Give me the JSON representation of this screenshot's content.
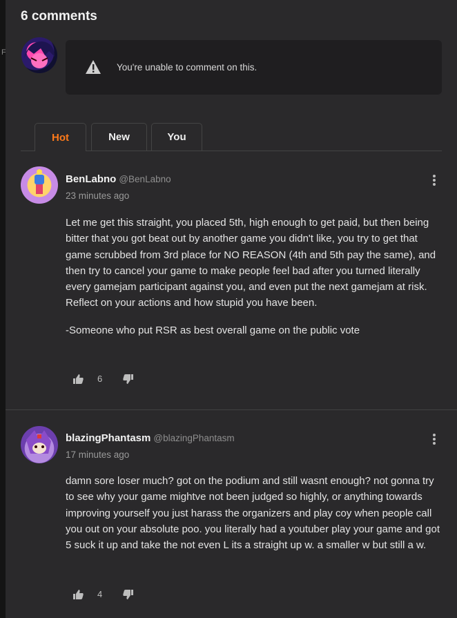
{
  "comments_header": {
    "title": "6 comments"
  },
  "notice": {
    "text": "You're unable to comment on this.",
    "icon": "warning-icon"
  },
  "tabs": [
    {
      "label": "Hot",
      "active": true
    },
    {
      "label": "New",
      "active": false
    },
    {
      "label": "You",
      "active": false
    }
  ],
  "sidebar": {
    "partial_letter": "F"
  },
  "colors": {
    "accent": "#ff7a1a",
    "background": "#2a292b",
    "notice_bg": "#1f1e20"
  },
  "comments": [
    {
      "name": "BenLabno",
      "handle": "@BenLabno",
      "time": "23 minutes ago",
      "paragraphs": [
        "Let me get this straight, you placed 5th, high enough to get paid, but then being bitter that you got beat out by another game you didn't like, you try to get that game scrubbed from 3rd place for NO REASON (4th and 5th pay the same), and then try to cancel your game to make people feel bad after you turned literally every gamejam participant against you, and even put the next gamejam at risk. Reflect on your actions and how stupid you have been.",
        "-Someone who put RSR as best overall game on the public vote"
      ],
      "likes": "6"
    },
    {
      "name": "blazingPhantasm",
      "handle": "@blazingPhantasm",
      "time": "17 minutes ago",
      "paragraphs": [
        "damn sore loser much? got on the podium and still wasnt enough? not gonna try to see why your game mightve not been judged so highly, or anything towards improving yourself you just harass the organizers and play coy when people call you out on your absolute poo. you literally had a youtuber play your game and got 5 suck it up and take the not even L its a straight up w. a smaller w but still a w."
      ],
      "likes": "4"
    }
  ]
}
